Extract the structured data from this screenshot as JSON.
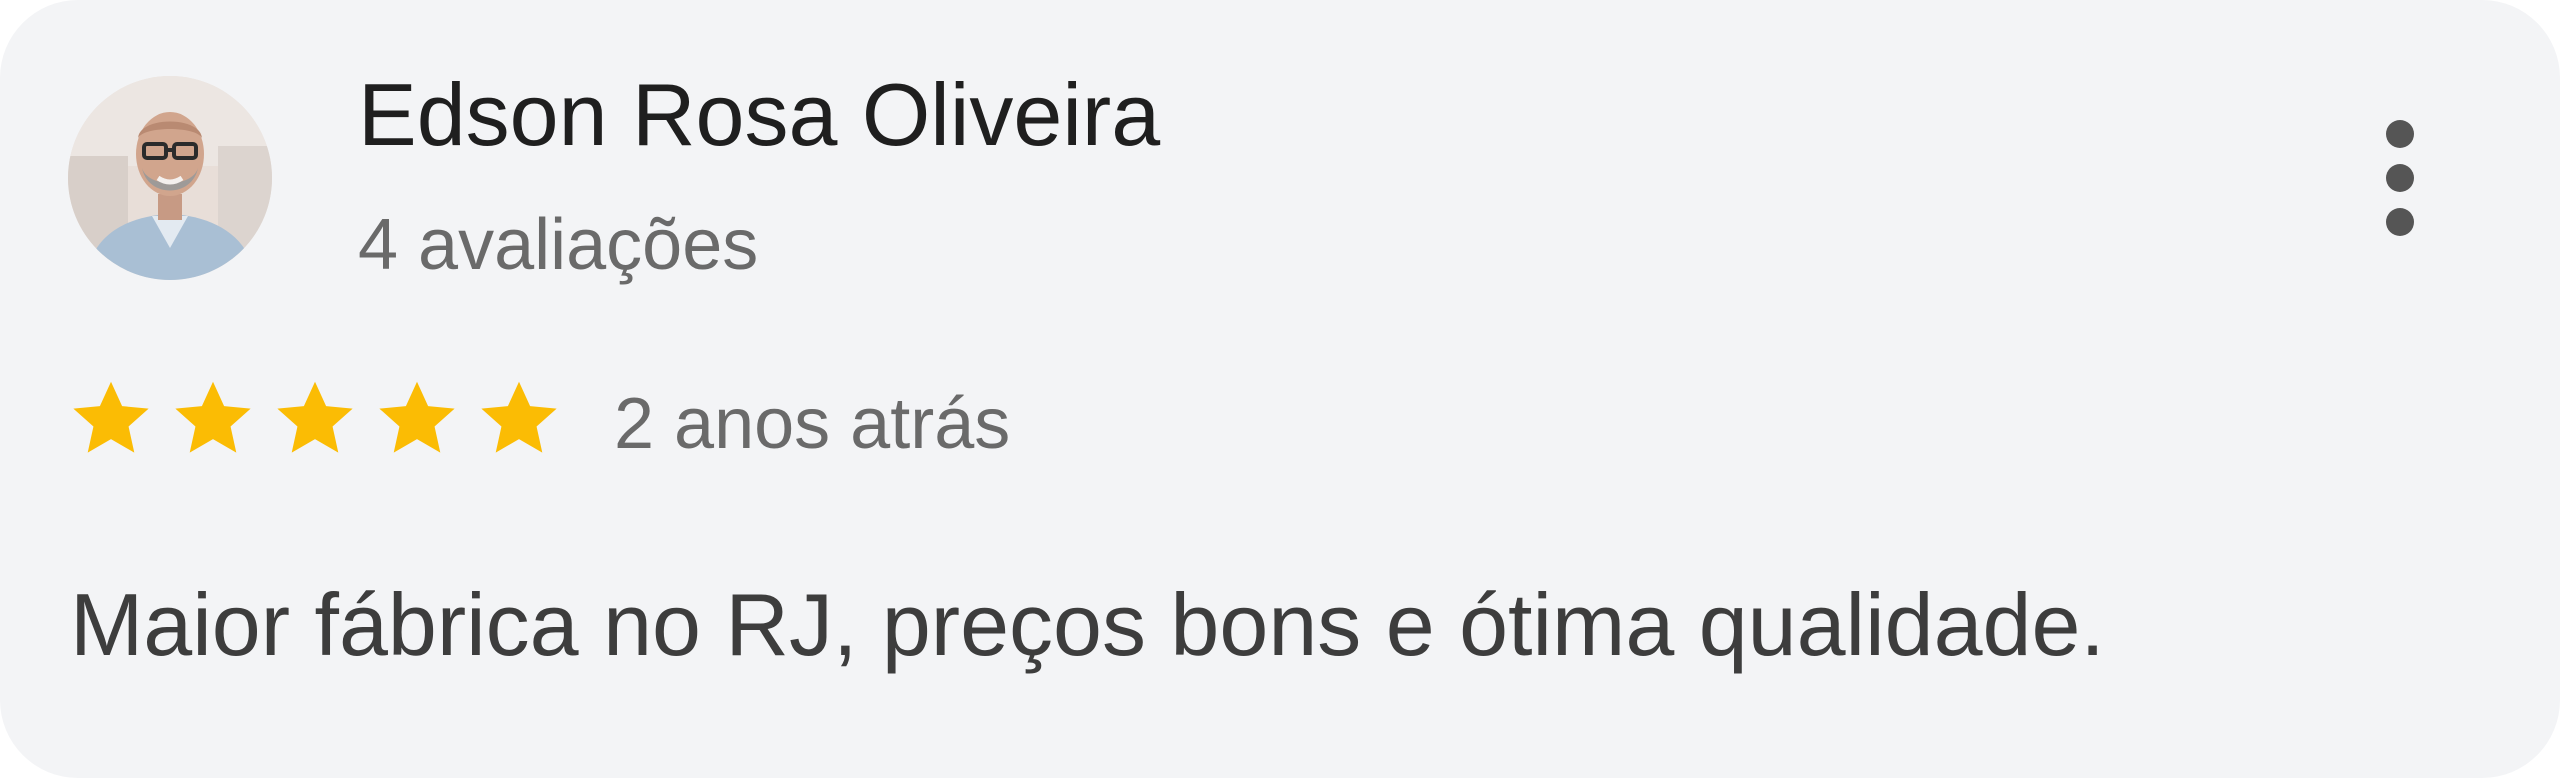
{
  "review": {
    "reviewer_name": "Edson Rosa Oliveira",
    "review_count": "4 avaliações",
    "rating": 5,
    "rating_max": 5,
    "date": "2 anos atrás",
    "text": "Maior fábrica no RJ, preços bons e ótima qualidade."
  },
  "icons": {
    "avatar": "profile-photo-icon",
    "more": "more-vertical-icon",
    "star": "star-icon"
  },
  "colors": {
    "card_background": "#f3f4f6",
    "star_fill": "#fbbc04",
    "name_text": "#1f1f1f",
    "meta_text": "#6a6a6a",
    "body_text": "#3d3d3d"
  }
}
